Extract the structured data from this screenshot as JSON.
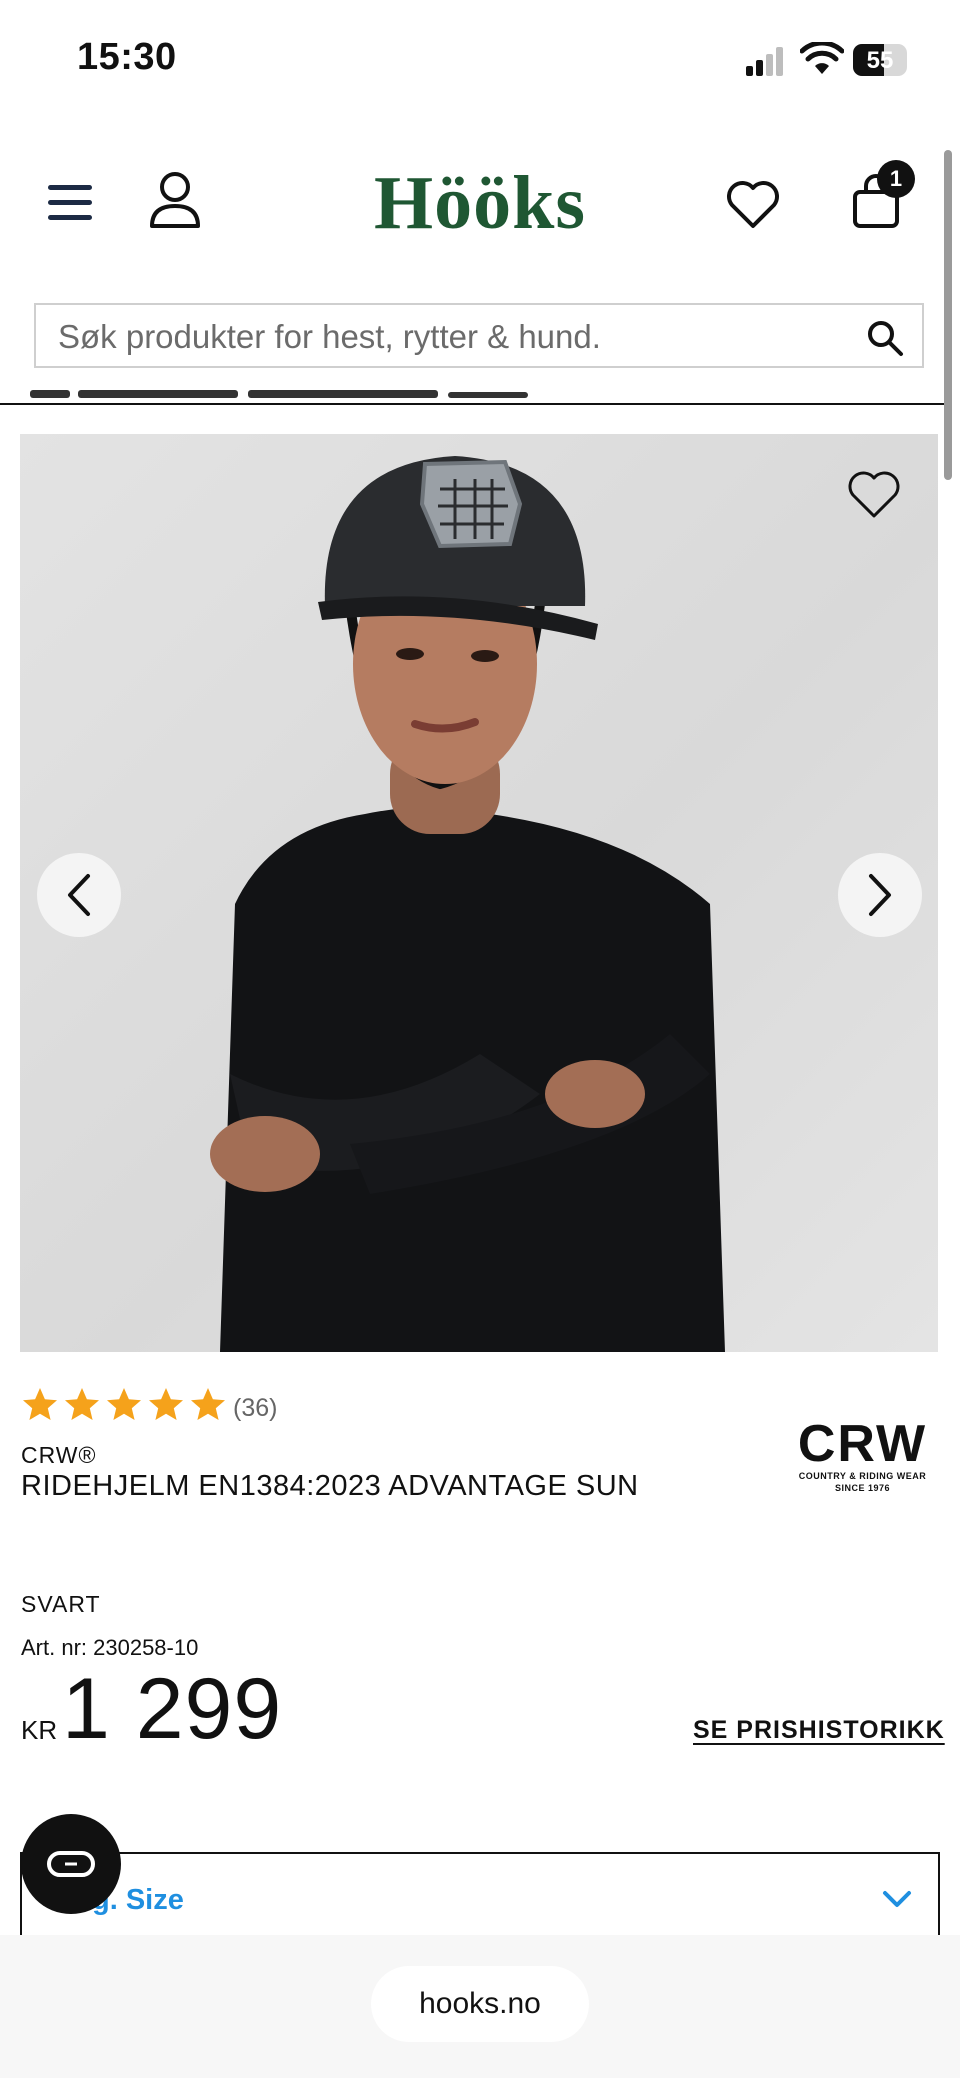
{
  "status_bar": {
    "time": "15:30",
    "battery": "55"
  },
  "header": {
    "logo": "Hööks",
    "cart_count": "1"
  },
  "search": {
    "placeholder": "Søk produkter for hest, rytter & hund."
  },
  "product": {
    "rating": 5,
    "review_count": "(36)",
    "brand": "CRW®",
    "name": "RIDEHJELM EN1384:2023 ADVANTAGE SUN",
    "brand_logo_main": "CRW",
    "brand_logo_sub1": "COUNTRY & RIDING WEAR",
    "brand_logo_sub2": "SINCE 1976",
    "color": "SVART",
    "article_number": "Art. nr: 230258-10",
    "currency": "KR",
    "price": "1 299",
    "price_history_link": "SE PRISHISTORIKK",
    "size_select_label": "g. Size"
  },
  "browser": {
    "url": "hooks.no"
  },
  "colors": {
    "logo_green": "#1f5733",
    "star_orange": "#f5a21b",
    "accent_blue": "#1f8fe0"
  },
  "icons": [
    "menu-icon",
    "user-icon",
    "heart-icon",
    "cart-icon",
    "search-icon",
    "chevron-left-icon",
    "chevron-right-icon",
    "star-icon",
    "chevron-down-icon",
    "chat-icon"
  ]
}
